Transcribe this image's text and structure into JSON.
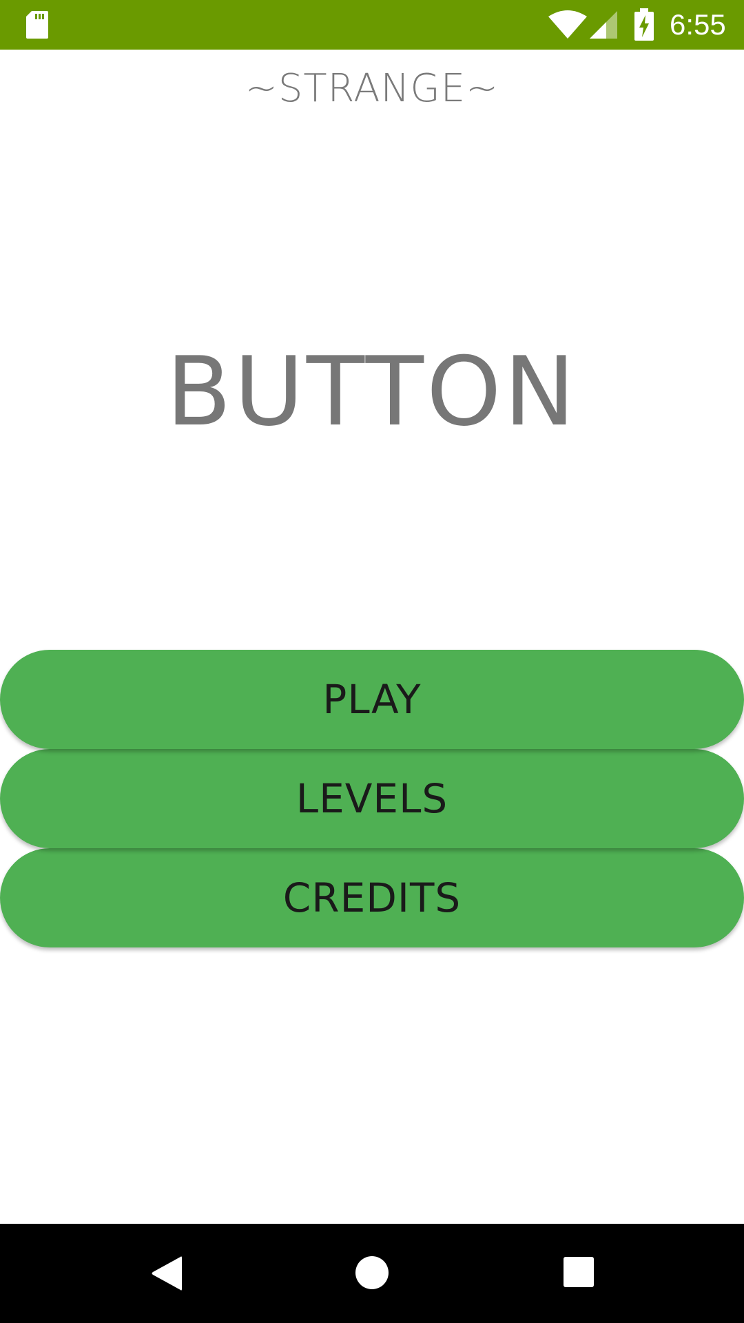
{
  "status_bar": {
    "time": "6:55",
    "bg_color": "#6a9a00",
    "icons": [
      "sd-card-icon",
      "wifi-icon",
      "cell-signal-icon",
      "battery-charging-icon"
    ]
  },
  "header": {
    "subtitle": "~STRANGE~",
    "title": "BUTTON"
  },
  "menu": {
    "play_label": "PLAY",
    "levels_label": "LEVELS",
    "credits_label": "CREDITS",
    "button_color": "#4fb053"
  },
  "nav_bar": {
    "icons": [
      "back-icon",
      "home-icon",
      "recents-icon"
    ]
  }
}
